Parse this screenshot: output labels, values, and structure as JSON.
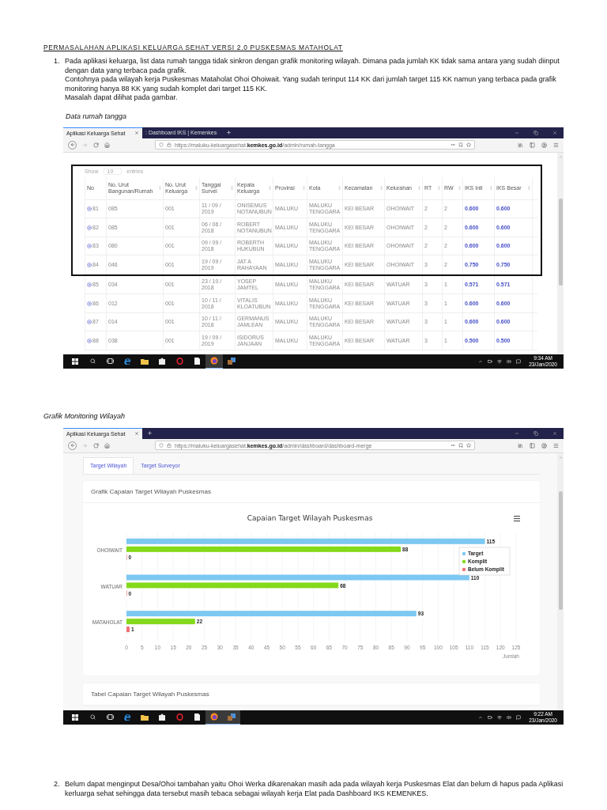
{
  "title": "PERMASALAHAN APLIKASI KELUARGA SEHAT VERSI 2.0 PUSKESMAS MATAHOLAT",
  "intro_item": {
    "number": "1.",
    "paragraphs": [
      "Pada aplikasi keluarga, list data rumah tangga tidak sinkron dengan grafik monitoring wilayah. Dimana pada jumlah KK tidak sama antara yang sudah diinput dengan data yang terbaca pada grafik.",
      "Contohnya pada wilayah kerja Puskesmas Mataholat Ohoi Ohoiwait. Yang sudah terinput 114 KK dari jumlah target 115 KK namun yang terbaca pada grafik monitoring hanya 88 KK yang sudah komplet dari target 115 KK.",
      "Masalah dapat dilihat pada gambar."
    ]
  },
  "figure_1": {
    "caption": "Data rumah tangga",
    "browser": {
      "tabs": [
        {
          "label": "Aplikasi Keluarga Sehat",
          "selected": true
        },
        {
          "label": ": Dashboard IKS | Kemenkes",
          "selected": false
        }
      ],
      "url": "https://maluku-keluargasehat.**kemkes.go.id**/admin/rumah-tangga",
      "page": {
        "kind": "table",
        "show_label": "Show",
        "page_size": "10",
        "entries_label": "entries",
        "columns": [
          {
            "label": "No",
            "kind": "expand"
          },
          {
            "label": "No. Urut Bangunan/Rumah",
            "kind": "text"
          },
          {
            "label": "No. Urut Keluarga",
            "kind": "text"
          },
          {
            "label": "Tanggal Survei",
            "kind": "text"
          },
          {
            "label": "Kepala Keluarga",
            "kind": "text"
          },
          {
            "label": "Provinsi",
            "kind": "text"
          },
          {
            "label": "Kota",
            "kind": "text"
          },
          {
            "label": "Kecamatan",
            "kind": "text"
          },
          {
            "label": "Kelurahan",
            "kind": "text"
          },
          {
            "label": "RT",
            "kind": "text"
          },
          {
            "label": "RW",
            "kind": "text"
          },
          {
            "label": "IKS Inti",
            "kind": "score"
          },
          {
            "label": "IKS Besar",
            "kind": "score"
          }
        ],
        "framed_rows": [
          {
            "cells": [
              "81",
              "085",
              "001",
              "11 / 09 / 2019",
              "ONISEMUS NOTANUBUN",
              "MALUKU",
              "MALUKU TENGGARA",
              "KEI BESAR",
              "OHOIWAIT",
              "2",
              "2",
              "0.600",
              "0.600"
            ]
          },
          {
            "cells": [
              "82",
              "085",
              "001",
              "06 / 06 / 2018",
              "ROBERT NOTANUBUN",
              "MALUKU",
              "MALUKU TENGGARA",
              "KEI BESAR",
              "OHOIWAIT",
              "2",
              "2",
              "0.600",
              "0.600"
            ]
          },
          {
            "cells": [
              "83",
              "080",
              "001",
              "09 / 09 / 2018",
              "ROBERTH HUKUBUN",
              "MALUKU",
              "MALUKU TENGGARA",
              "KEI BESAR",
              "OHOIWAIT",
              "2",
              "2",
              "0.600",
              "0.600"
            ]
          },
          {
            "cells": [
              "84",
              "046",
              "001",
              "19 / 09 / 2019",
              "JAT A RAHAYAAN",
              "MALUKU",
              "MALUKU TENGGARA",
              "KEI BESAR",
              "OHOIWAIT",
              "3",
              "2",
              "0.750",
              "0.750"
            ]
          }
        ],
        "rows": [
          {
            "cells": [
              "85",
              "034",
              "001",
              "23 / 10 / 2018",
              "YOSEP JAMTEL",
              "MALUKU",
              "MALUKU TENGGARA",
              "KEI BESAR",
              "WATUAR",
              "3",
              "1",
              "0.571",
              "0.571"
            ]
          },
          {
            "cells": [
              "86",
              "012",
              "001",
              "10 / 11 / 2018",
              "VITALIS KLOATUBUN",
              "MALUKU",
              "MALUKU TENGGARA",
              "KEI BESAR",
              "WATUAR",
              "3",
              "1",
              "0.600",
              "0.600"
            ]
          },
          {
            "cells": [
              "87",
              "014",
              "001",
              "10 / 11 / 2018",
              "GERMANUS JAMLEAN",
              "MALUKU",
              "MALUKU TENGGARA",
              "KEI BESAR",
              "WATUAR",
              "3",
              "1",
              "0.600",
              "0.600"
            ]
          },
          {
            "cells": [
              "88",
              "038",
              "001",
              "19 / 09 / 2019",
              "ISIDORUS JANJAAN",
              "MALUKU",
              "MALUKU TENGGARA",
              "KEI BESAR",
              "WATUAR",
              "3",
              "1",
              "0.500",
              "0.500"
            ]
          }
        ]
      },
      "taskbar": {
        "apps": [
          {
            "kind": "edge",
            "selected": false
          },
          {
            "kind": "explorer",
            "selected": false
          },
          {
            "kind": "store",
            "selected": false
          },
          {
            "kind": "opera",
            "selected": false
          },
          {
            "kind": "notepad",
            "selected": false
          },
          {
            "kind": "firefox",
            "selected": true
          },
          {
            "kind": "app",
            "selected": false
          }
        ],
        "time": "9:34 AM",
        "date": "23/Jan/2020"
      }
    }
  },
  "figure_2": {
    "caption": "Grafik Monitoring Wilayah",
    "browser": {
      "tabs": [
        {
          "label": "Aplikasi Keluarga Sehat",
          "selected": true
        }
      ],
      "url": "https://maluku-keluargasehat.**kemkes.go.id**/admin/dashboard/dashboard-merge",
      "page": {
        "kind": "dashboard",
        "page_tabs": [
          {
            "label": "Target Wilayah",
            "selected": true
          },
          {
            "label": "Target Surveyor",
            "selected": false
          }
        ],
        "card_title": "Grafik Capaian Target Wilayah Puskesmas",
        "chart_data": {
          "type": "bar",
          "orientation": "horizontal",
          "title": "Capaian Target Wilayah Puskesmas",
          "xlabel": "Jumlah",
          "categories": [
            "OHOIWAIT",
            "WATUAR",
            "MATAHOLAT"
          ],
          "series": [
            {
              "name": "Target",
              "color": "#7cc8f2",
              "values": [
                115,
                110,
                93
              ]
            },
            {
              "name": "Komplit",
              "color": "#84d91a",
              "values": [
                88,
                68,
                22
              ]
            },
            {
              "name": "Belum Komplit",
              "color": "#f07076",
              "values": [
                0,
                0,
                1
              ]
            }
          ],
          "xlim": [
            0,
            125
          ],
          "grid": true,
          "xticks": [
            0,
            5,
            10,
            15,
            20,
            25,
            30,
            35,
            40,
            45,
            50,
            55,
            60,
            65,
            70,
            75,
            80,
            85,
            90,
            95,
            100,
            105,
            110,
            115,
            120,
            125
          ],
          "data_labels": true
        },
        "next_card_title": "Tabel Capaian Target Wilayah Puskesmas"
      },
      "taskbar": {
        "apps": [
          {
            "kind": "edge",
            "selected": false
          },
          {
            "kind": "explorer",
            "selected": false
          },
          {
            "kind": "store",
            "selected": false
          },
          {
            "kind": "opera",
            "selected": false
          },
          {
            "kind": "notepad",
            "selected": false
          },
          {
            "kind": "firefox",
            "selected": true
          },
          {
            "kind": "app",
            "selected": true
          }
        ],
        "time": "9:22 AM",
        "date": "23/Jan/2020"
      }
    }
  },
  "closing_item": {
    "number": "2.",
    "paragraphs": [
      "Belum dapat menginput Desa/Ohoi tambahan yaitu Ohoi Werka dikarenakan masih ada pada wilayah kerja Puskesmas Elat dan belum di hapus pada Aplikasi kerluarga sehat sehingga data tersebut masih tebaca sebagai wilayah kerja Elat pada Dashboard IKS KEMENKES."
    ]
  }
}
